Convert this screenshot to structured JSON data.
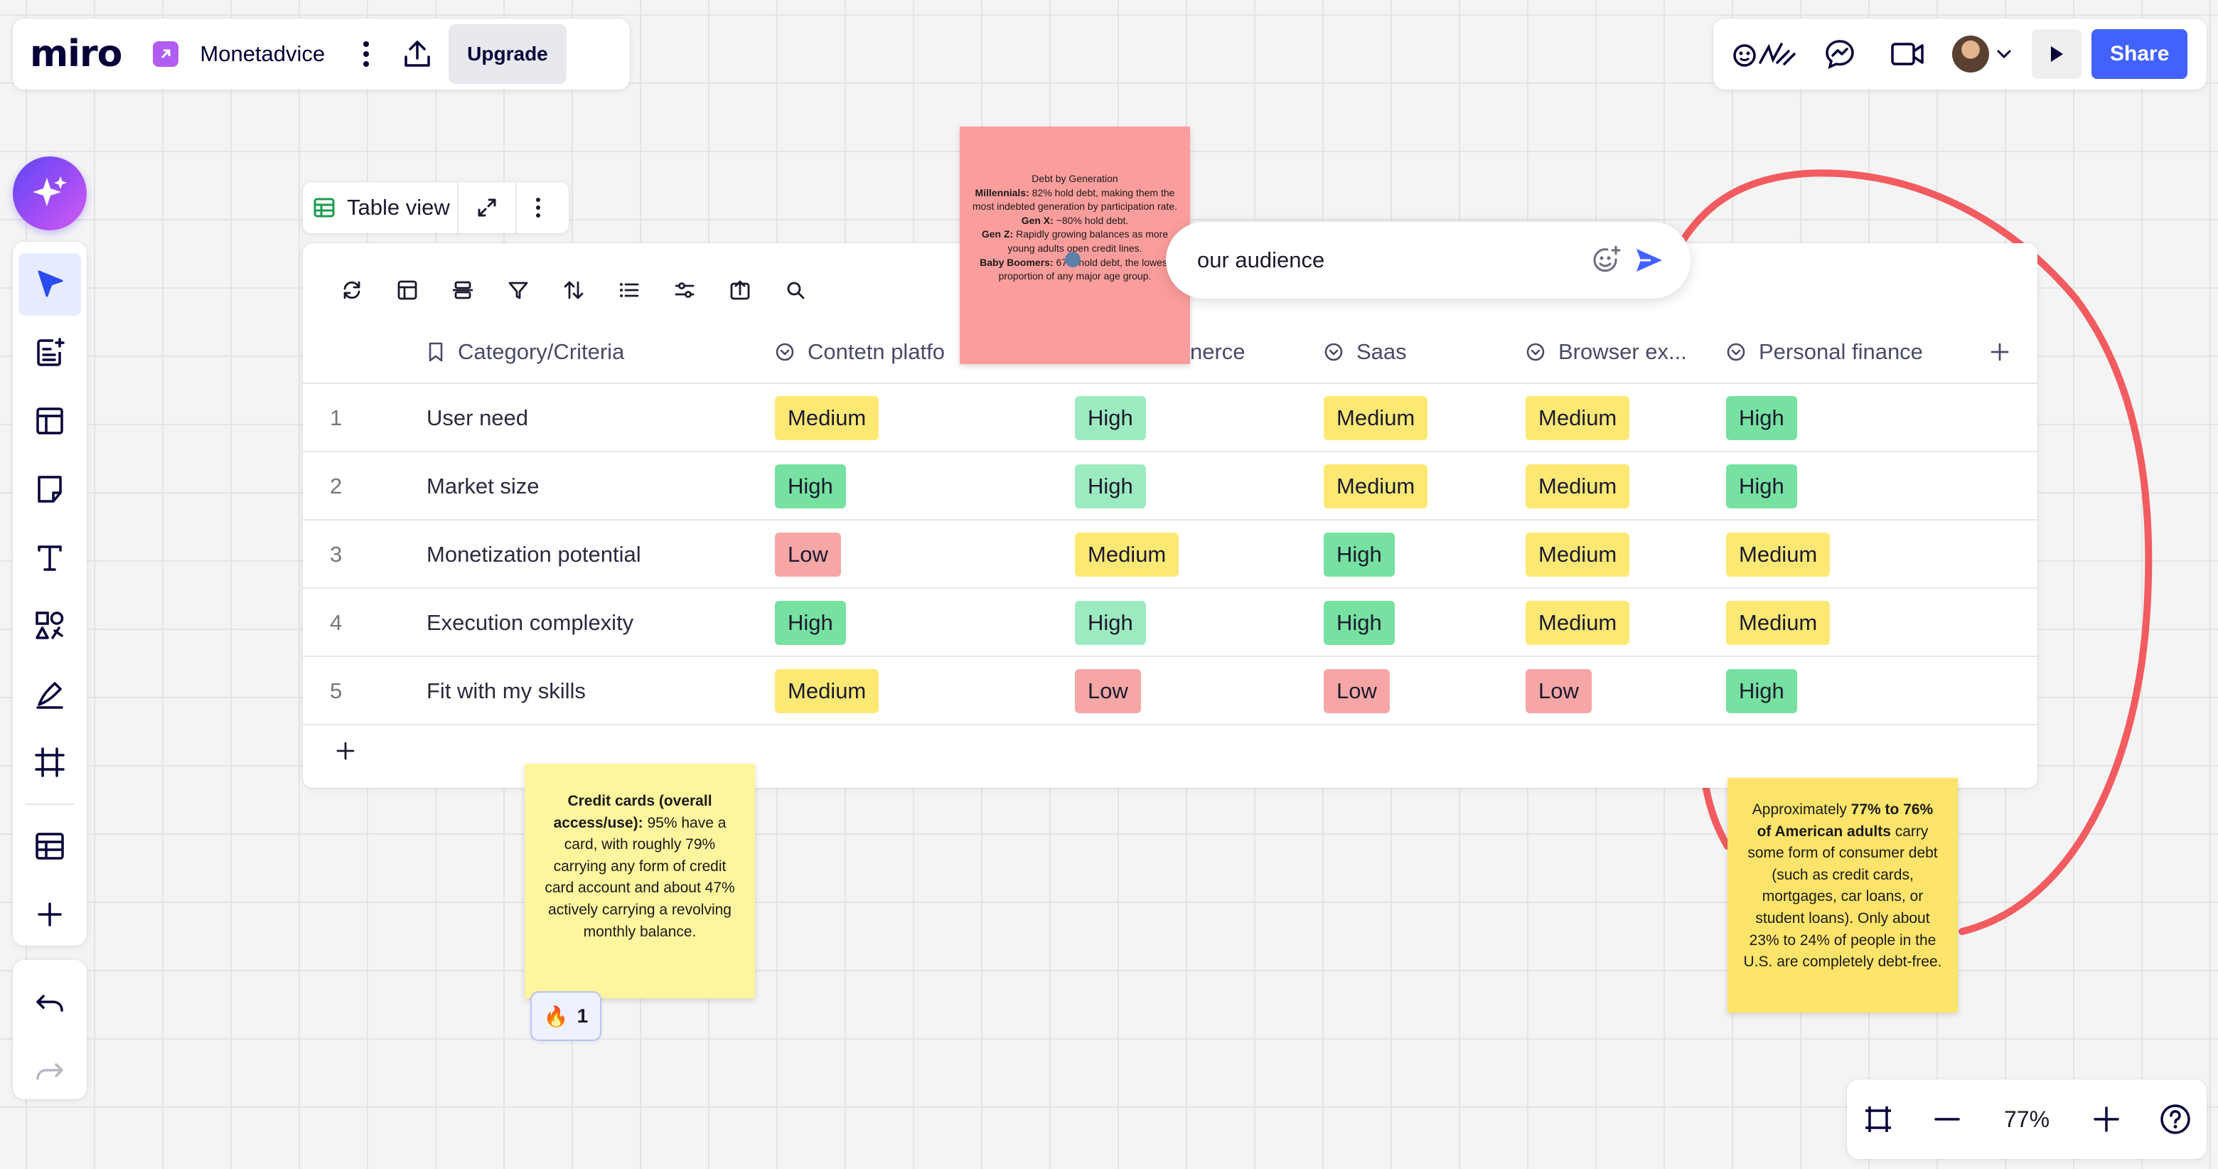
{
  "app": {
    "logo": "miro",
    "board_name": "Monetadvice",
    "upgrade_label": "Upgrade",
    "share_label": "Share",
    "reactions_icon": "reactions-icon"
  },
  "table_view": {
    "label": "Table view"
  },
  "table": {
    "columns": [
      "Category/Criteria",
      "Contetn platfo",
      "nerce",
      "Saas",
      "Browser ex...",
      "Personal finance"
    ],
    "rows": [
      {
        "num": "1",
        "criteria": "User need",
        "values": [
          "Medium",
          "High",
          "Medium",
          "Medium",
          "High"
        ]
      },
      {
        "num": "2",
        "criteria": "Market size",
        "values": [
          "High",
          "High",
          "Medium",
          "Medium",
          "High"
        ]
      },
      {
        "num": "3",
        "criteria": "Monetization potential",
        "values": [
          "Low",
          "Medium",
          "High",
          "Medium",
          "Medium"
        ]
      },
      {
        "num": "4",
        "criteria": "Execution complexity",
        "values": [
          "High",
          "High",
          "High",
          "Medium",
          "Medium"
        ]
      },
      {
        "num": "5",
        "criteria": "Fit with my skills",
        "values": [
          "Medium",
          "Low",
          "Low",
          "Low",
          "High"
        ]
      }
    ]
  },
  "sticky_red": {
    "title": "Debt by Generation",
    "l1_bold": "Millennials:",
    "l1": " 82% hold debt, making them the most indebted generation by participation rate.",
    "l2_bold": "Gen X:",
    "l2": " ~80% hold debt.",
    "l3_bold": "Gen Z:",
    "l3": " Rapidly growing balances as more young adults open credit lines.",
    "l4_bold": "Baby Boomers:",
    "l4": " 67% hold debt, the lowest proportion of any major age group."
  },
  "sticky_left": {
    "bold": "Credit cards (overall access/use):",
    "text": " 95% have a card, with roughly 79% carrying any form of credit card account and about 47% actively carrying a revolving monthly balance."
  },
  "sticky_right": {
    "pre": "Approximately ",
    "bold": "77% to 76% of American adults",
    "text": " carry some form of consumer debt (such as credit cards, mortgages, car loans, or student loans). Only about 23% to 24% of people in the U.S. are completely debt-free."
  },
  "reaction": {
    "emoji": "🔥",
    "count": "1"
  },
  "comment": {
    "value": "our audience"
  },
  "zoom": {
    "level": "77%"
  },
  "colors": {
    "accent": "#4262ff",
    "pen": "#f25b5f",
    "medium": "#fde874",
    "high": "#76e1a1",
    "low": "#f7a6a6"
  }
}
